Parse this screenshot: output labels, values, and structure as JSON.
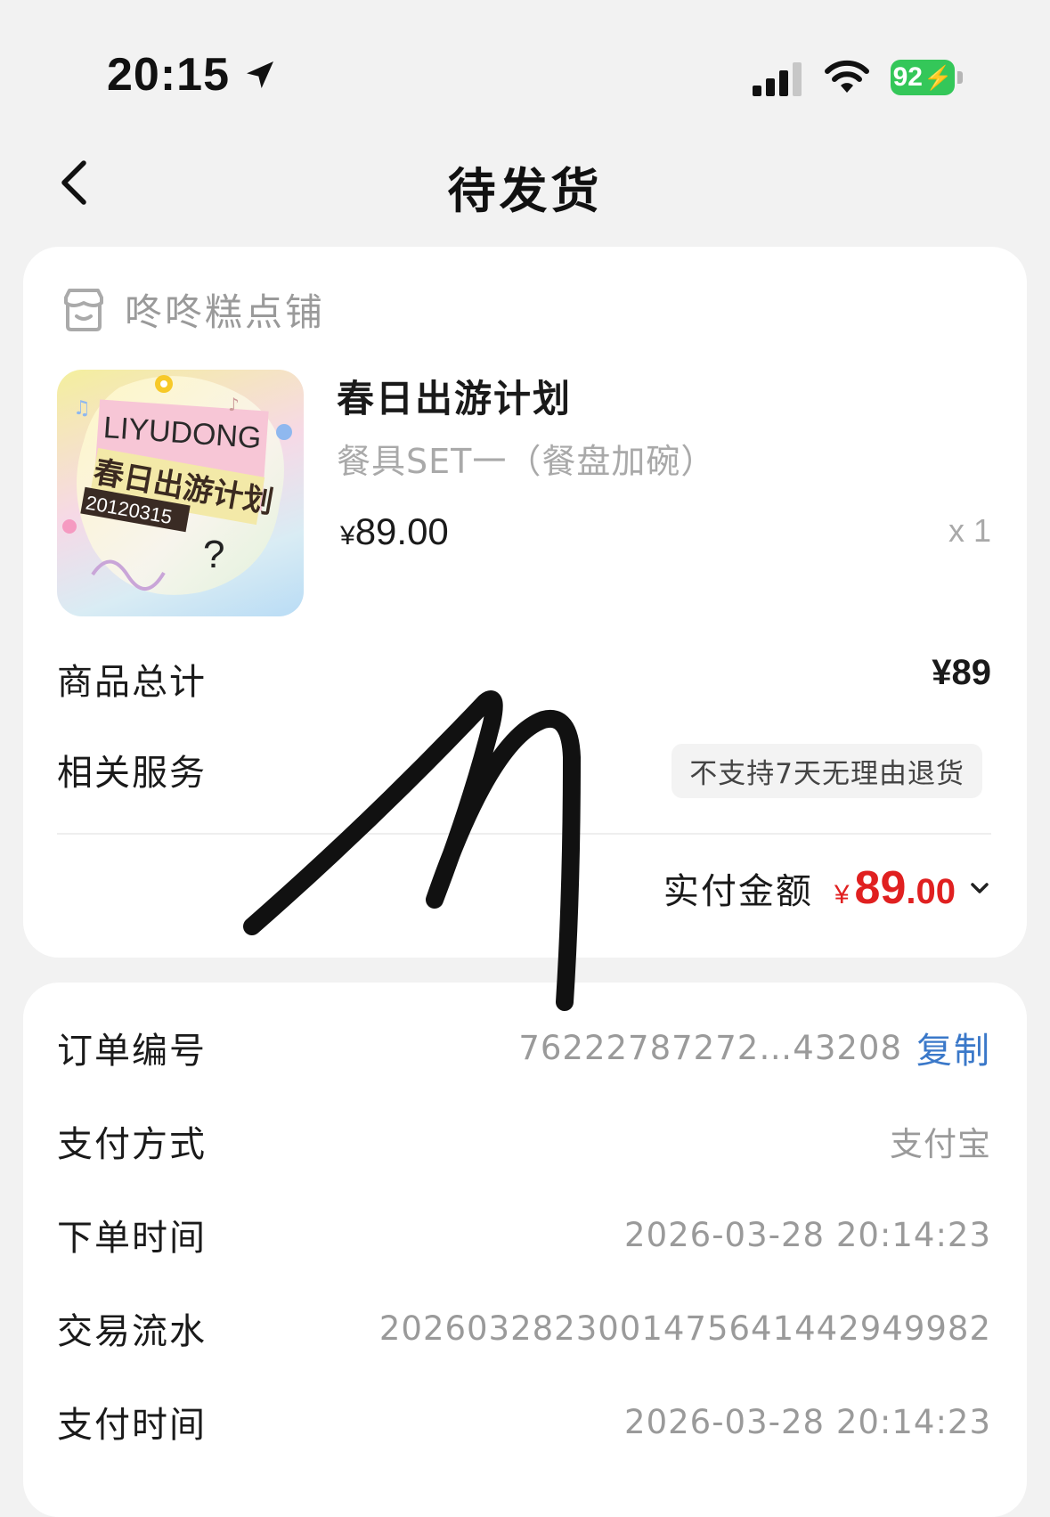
{
  "status_bar": {
    "time": "20:15",
    "battery": "92",
    "icons": [
      "location-arrow-icon",
      "cellular-signal-icon",
      "wifi-icon",
      "battery-charging-icon"
    ],
    "battery_color": "#34c759"
  },
  "nav": {
    "title": "待发货",
    "back_icon": "chevron-left-icon"
  },
  "order": {
    "store_name": "咚咚糕点铺",
    "store_icon": "storefront-icon",
    "product": {
      "title": "春日出游计划",
      "variant": "餐具SET一（餐盘加碗）",
      "price_symbol": "¥",
      "price": "89.00",
      "quantity": "x 1",
      "thumbnail": {
        "brand": "LIYUDONG",
        "title": "春日出游计划",
        "date": "20120315"
      }
    },
    "subtotal_label": "商品总计",
    "subtotal_value": "¥89",
    "service_label": "相关服务",
    "service_badge": "不支持7天无理由退货",
    "paid_label": "实付金额",
    "paid_symbol": "¥",
    "paid_int": "89",
    "paid_dec": ".00",
    "paid_color": "#e02020",
    "expand_icon": "chevron-down-icon"
  },
  "info": {
    "order_no_label": "订单编号",
    "order_no_value": "76222787272…43208",
    "copy_label": "复制",
    "copy_color": "#3a78c9",
    "pay_method_label": "支付方式",
    "pay_method_value": "支付宝",
    "order_time_label": "下单时间",
    "order_time_value": "2026-03-28 20:14:23",
    "trade_no_label": "交易流水",
    "trade_no_value": "2026032823001475641442949982",
    "pay_time_label": "支付时间",
    "pay_time_value": "2026-03-28 20:14:23"
  }
}
